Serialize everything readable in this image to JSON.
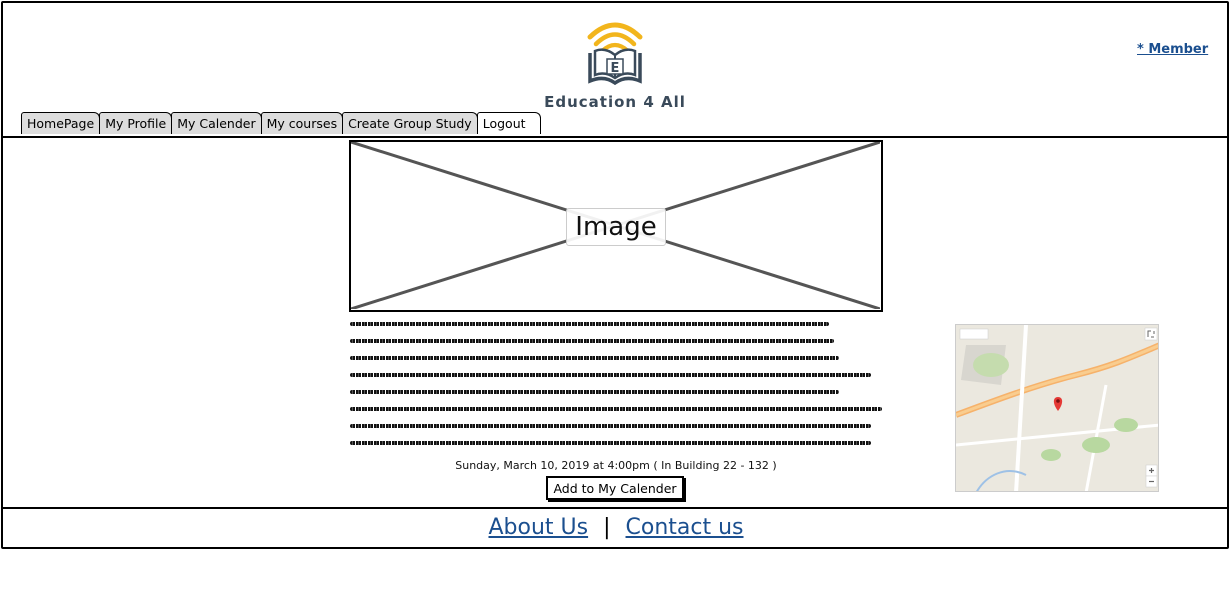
{
  "header": {
    "logo_text": "Education 4 All",
    "logo_letter": "E",
    "member_link": "* Member"
  },
  "tabs": [
    "HomePage",
    "My Profile",
    "My Calender",
    "My courses",
    "Create Group Study",
    "Logout"
  ],
  "main": {
    "image_placeholder_label": "Image",
    "event_text": "Sunday, March 10, 2019 at 4:00pm ( In Building 22 - 132 )",
    "add_button_label": "Add to My Calender"
  },
  "footer": {
    "about_label": "About Us",
    "separator": "|",
    "contact_label": "Contact us"
  },
  "colors": {
    "link": "#1b4f8f",
    "logo_arc": "#f2b51c",
    "logo_text": "#3a4a5a"
  },
  "icons": [
    "book-wifi-logo-icon",
    "map-pin-icon",
    "zoom-plus-icon",
    "zoom-minus-icon",
    "fullscreen-icon"
  ]
}
